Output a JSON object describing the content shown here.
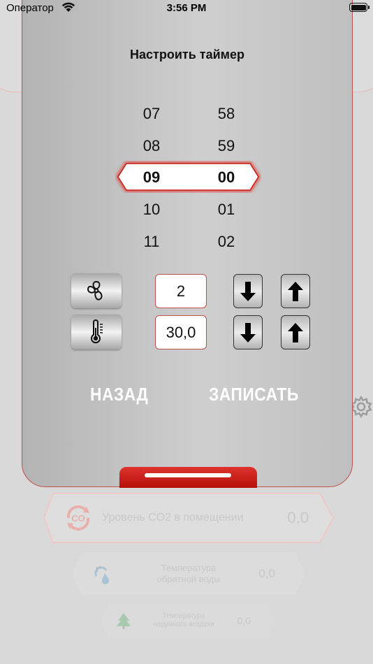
{
  "status_bar": {
    "carrier": "Оператор",
    "time": "3:56 PM"
  },
  "dialog": {
    "title": "Настроить таймер",
    "picker": {
      "hours": [
        "07",
        "08",
        "09",
        "10",
        "11"
      ],
      "minutes": [
        "58",
        "59",
        "00",
        "01",
        "02"
      ],
      "selected_hour": "09",
      "selected_minute": "00"
    },
    "fan_value": "2",
    "temperature_value": "30,0",
    "back_label": "НАЗАД",
    "save_label": "ЗАПИСАТЬ"
  },
  "background_sensors": [
    {
      "label": "Уровень CO2 в помещении",
      "value": "0,0",
      "icon": "co2-icon"
    },
    {
      "label": "Температура обратной воды",
      "value": "0,0",
      "icon": "water-temperature-icon"
    },
    {
      "label": "Температура наружного воздуха",
      "value": "0,0",
      "icon": "outdoor-tree-icon"
    }
  ],
  "colors": {
    "accent_red": "#c0504a",
    "handle_red": "#d32f2a",
    "dialog_gray": "#c4c4c4"
  }
}
